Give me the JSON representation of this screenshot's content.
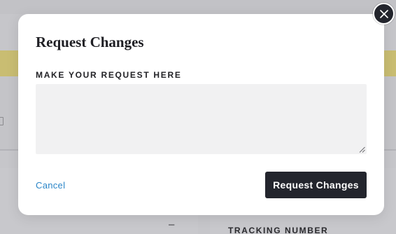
{
  "background": {
    "dash_text": "–",
    "tracking_label": "TRACKING NUMBER"
  },
  "modal": {
    "title": "Request Changes",
    "field_label": "MAKE YOUR REQUEST HERE",
    "textarea_value": "",
    "cancel_label": "Cancel",
    "submit_label": "Request Changes",
    "close_icon": "close-icon"
  },
  "colors": {
    "accent_link": "#2b86c8",
    "button_dark": "#23252d",
    "textarea_bg": "#f1f1f2",
    "warning_band": "#c9bd72"
  }
}
